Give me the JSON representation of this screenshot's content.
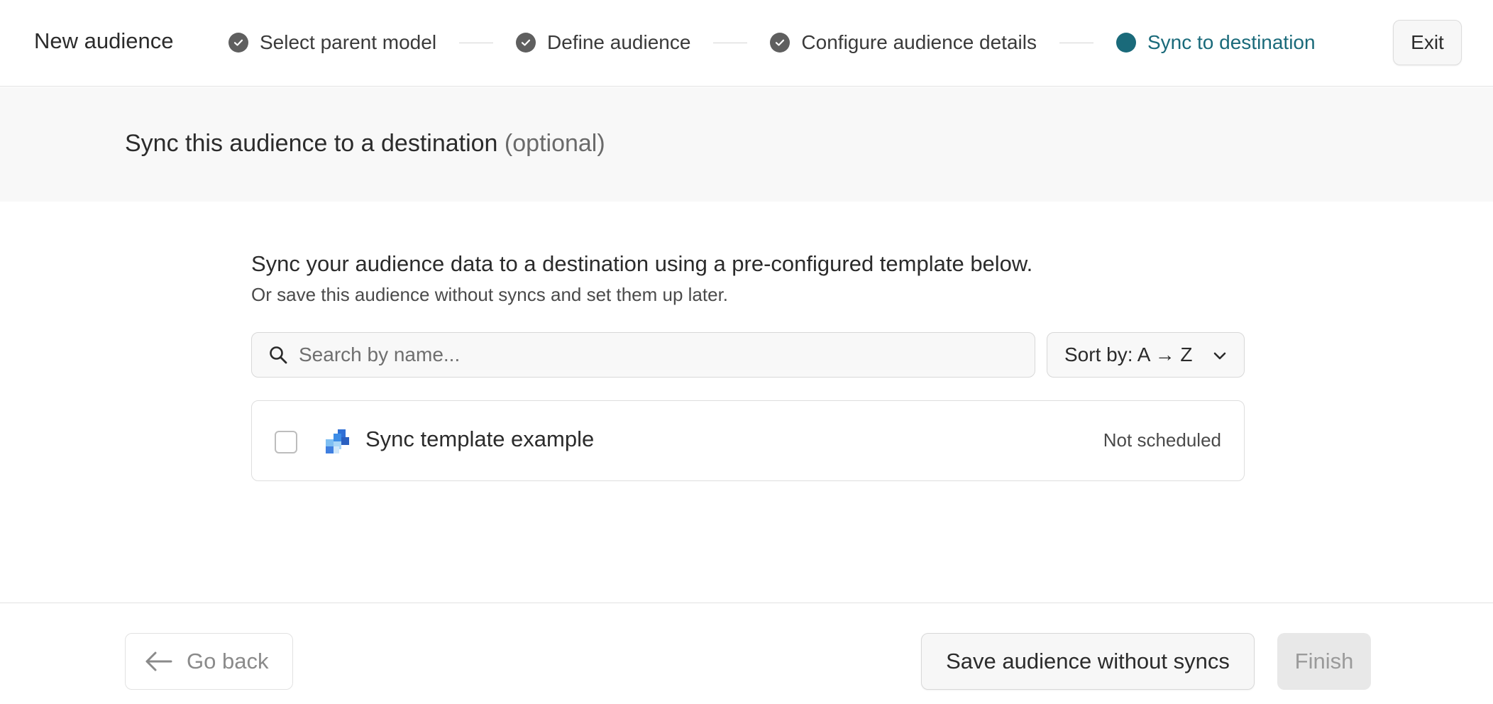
{
  "header": {
    "title": "New audience",
    "steps": [
      {
        "label": "Select parent model",
        "state": "complete"
      },
      {
        "label": "Define audience",
        "state": "complete"
      },
      {
        "label": "Configure audience details",
        "state": "complete"
      },
      {
        "label": "Sync to destination",
        "state": "current"
      }
    ],
    "exit_label": "Exit"
  },
  "subheader": {
    "title": "Sync this audience to a destination",
    "title_suffix": "(optional)"
  },
  "main": {
    "intro_primary": "Sync your audience data to a destination using a pre-configured template below.",
    "intro_secondary": "Or save this audience without syncs and set them up later.",
    "search": {
      "placeholder": "Search by name...",
      "value": ""
    },
    "sort": {
      "label": "Sort by: A → Z"
    },
    "templates": [
      {
        "name": "Sync template example",
        "status": "Not scheduled",
        "selected": false
      }
    ]
  },
  "footer": {
    "back_label": "Go back",
    "save_label": "Save audience without syncs",
    "finish_label": "Finish"
  },
  "colors": {
    "accent": "#1a6a7a",
    "step_complete": "#5f5f5f",
    "disabled_bg": "#e8e8e8"
  },
  "icons": {
    "step_complete": "check-circle-icon",
    "step_current": "dot-circle-icon",
    "search": "search-icon",
    "sort": "chevron-down-icon",
    "template": "pixel-squares-icon",
    "back": "arrow-left-icon"
  }
}
